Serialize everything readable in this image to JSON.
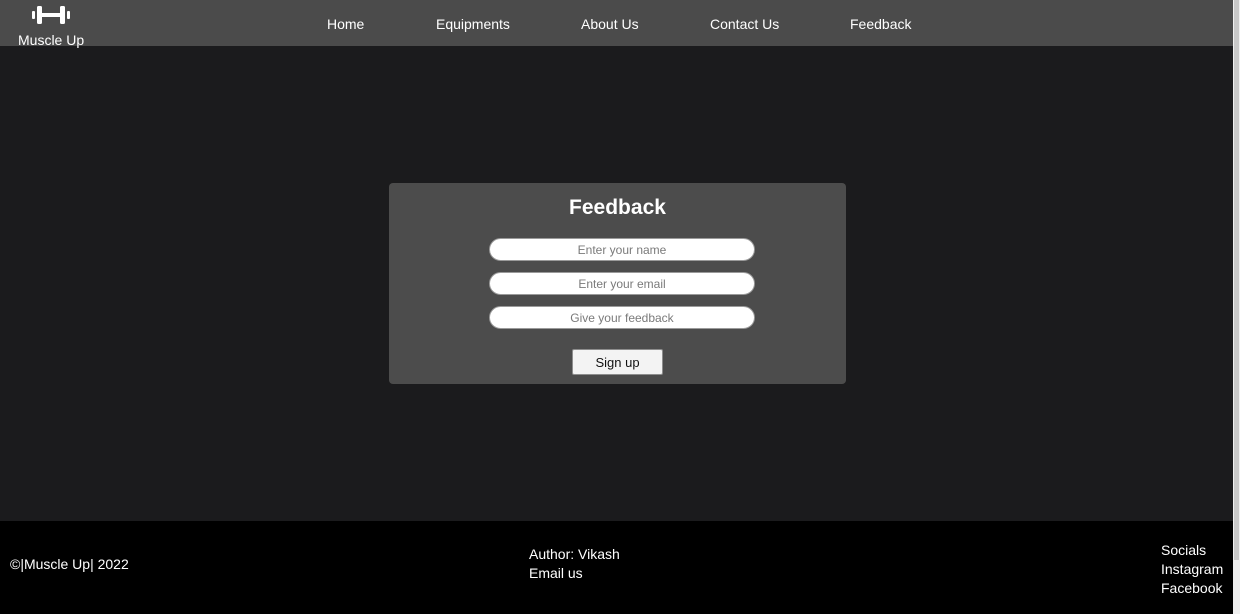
{
  "brand": {
    "name": "Muscle Up",
    "logo_icon": "dumbbell-icon"
  },
  "nav": {
    "items": [
      {
        "label": "Home"
      },
      {
        "label": "Equipments"
      },
      {
        "label": "About Us"
      },
      {
        "label": "Contact Us"
      },
      {
        "label": "Feedback"
      }
    ]
  },
  "form": {
    "title": "Feedback",
    "name_placeholder": "Enter your name",
    "email_placeholder": "Enter your email",
    "feedback_placeholder": "Give your feedback",
    "submit_label": "Sign up"
  },
  "footer": {
    "copyright": "©|Muscle Up| 2022",
    "author": "Author: Vikash",
    "email_link": "Email us",
    "socials_heading": "Socials",
    "instagram": "Instagram",
    "facebook": "Facebook"
  },
  "colors": {
    "navbar_bg": "#4b4b4b",
    "page_bg": "#1b1b1d",
    "card_bg": "#4c4c4c",
    "footer_bg": "#000000"
  }
}
